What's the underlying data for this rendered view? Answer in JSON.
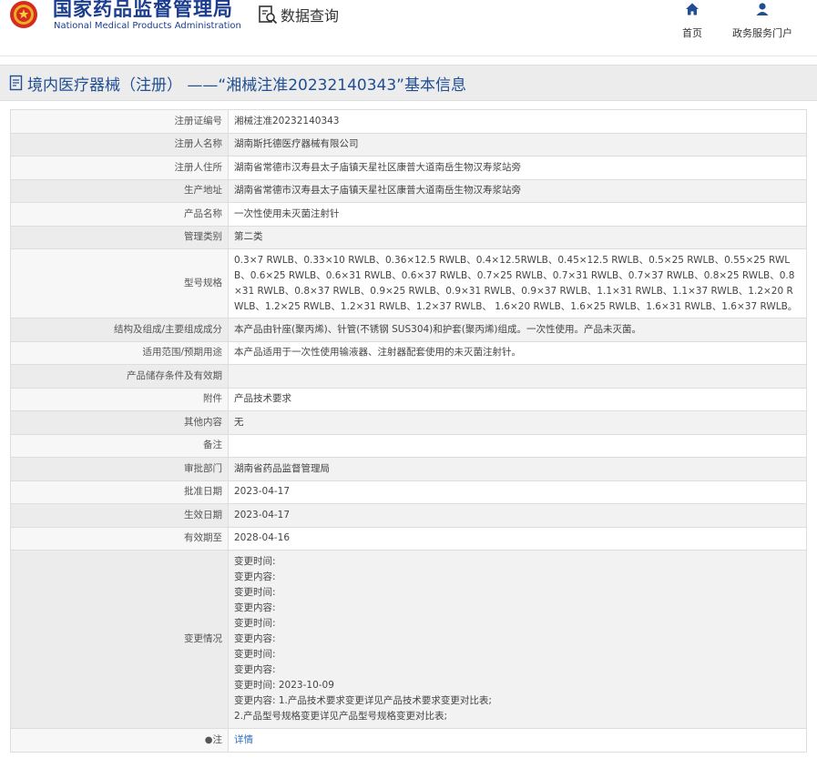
{
  "header": {
    "agency_name_cn": "国家药品监督管理局",
    "agency_name_en": "National Medical Products Administration",
    "search_label": "数据查询",
    "search_icon": "search-icon",
    "brand_color": "#1a3d8f"
  },
  "nav": {
    "home_label": "首页",
    "home_icon": "home-icon",
    "portal_label": "政务服务门户",
    "portal_icon": "user-icon"
  },
  "page": {
    "title": "境内医疗器械（注册） ——“湘械注准20232140343”基本信息",
    "title_color": "#1f4e94"
  },
  "fields": {
    "reg_no": {
      "label": "注册证编号",
      "value": "湘械注准20232140343"
    },
    "registrant": {
      "label": "注册人名称",
      "value": "湖南斯托德医疗器械有限公司"
    },
    "residence": {
      "label": "注册人住所",
      "value": "湖南省常德市汉寿县太子庙镇天星社区康普大道南岳生物汉寿浆站旁"
    },
    "factory": {
      "label": "生产地址",
      "value": "湖南省常德市汉寿县太子庙镇天星社区康普大道南岳生物汉寿浆站旁"
    },
    "product": {
      "label": "产品名称",
      "value": "一次性使用未灭菌注射针"
    },
    "category": {
      "label": "管理类别",
      "value": "第二类"
    },
    "model": {
      "label": "型号规格",
      "value": "0.3×7 RWLB、0.33×10 RWLB、0.36×12.5 RWLB、0.4×12.5RWLB、0.45×12.5 RWLB、0.5×25 RWLB、0.55×25 RWLB、0.6×25 RWLB、0.6×31 RWLB、0.6×37 RWLB、0.7×25 RWLB、0.7×31 RWLB、0.7×37 RWLB、0.8×25 RWLB、0.8×31 RWLB、0.8×37 RWLB、0.9×25 RWLB、0.9×31 RWLB、0.9×37 RWLB、1.1×31 RWLB、1.1×37 RWLB、1.2×20 RWLB、1.2×25 RWLB、1.2×31 RWLB、1.2×37 RWLB、 1.6×20 RWLB、1.6×25 RWLB、1.6×31 RWLB、1.6×37 RWLB。"
    },
    "structure": {
      "label": "结构及组成/主要组成成分",
      "value": "本产品由针座(聚丙烯)、针管(不锈钢 SUS304)和护套(聚丙烯)组成。一次性使用。产品未灭菌。"
    },
    "usage": {
      "label": "适用范围/预期用途",
      "value": "本产品适用于一次性使用输液器、注射器配套使用的未灭菌注射针。"
    },
    "storage": {
      "label": "产品储存条件及有效期",
      "value": ""
    },
    "attachment": {
      "label": "附件",
      "value": "产品技术要求"
    },
    "other": {
      "label": "其他内容",
      "value": "无"
    },
    "remark": {
      "label": "备注",
      "value": ""
    },
    "approver": {
      "label": "审批部门",
      "value": "湖南省药品监督管理局"
    },
    "approve_date": {
      "label": "批准日期",
      "value": "2023-04-17"
    },
    "effective_date": {
      "label": "生效日期",
      "value": "2023-04-17"
    },
    "expire_date": {
      "label": "有效期至",
      "value": "2028-04-16"
    },
    "changes": {
      "label": "变更情况",
      "lines": [
        "变更时间:",
        "变更内容:",
        "变更时间:",
        "变更内容:",
        "变更时间:",
        "变更内容:",
        "变更时间:",
        "变更内容:",
        "变更时间:  2023-10-09",
        "变更内容:  1.产品技术要求变更详见产品技术要求变更对比表;",
        "2.产品型号规格变更详见产品型号规格变更对比表;"
      ]
    },
    "note": {
      "label": "注",
      "value": "详情",
      "pin_icon": "location-pin-icon"
    }
  }
}
